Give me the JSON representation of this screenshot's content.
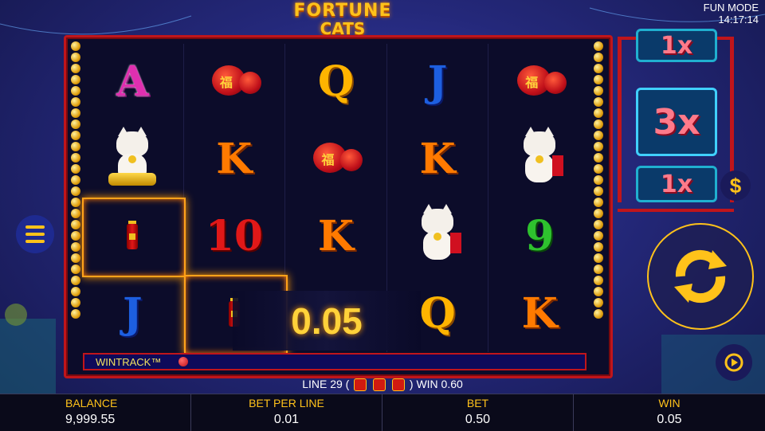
{
  "header": {
    "logo_line1": "FORTUNE",
    "logo_line2": "CATS",
    "mode": "FUN MODE",
    "time": "14:17:14"
  },
  "reels": [
    [
      "A",
      "lantern",
      "Q",
      "J",
      "lantern"
    ],
    [
      "cat-gold",
      "K",
      "lantern",
      "K",
      "cat"
    ],
    [
      "firecracker",
      "10",
      "K",
      "cat",
      "9"
    ],
    [
      "J",
      "firecracker",
      "",
      "Q",
      "K"
    ]
  ],
  "lantern_text": "福",
  "multipliers": [
    "1x",
    "3x",
    "1x"
  ],
  "win_popup": "0.05",
  "wintrack_label": "WINTRACK™",
  "line_info": {
    "line": "LINE 29 (",
    "close": ")",
    "win": "WIN 0.60"
  },
  "dollar_symbol": "$",
  "bottom": {
    "balance_label": "BALANCE",
    "balance_value": "9,999.55",
    "bet_per_line_label": "BET PER LINE",
    "bet_per_line_value": "0.01",
    "bet_label": "BET",
    "bet_value": "0.50",
    "win_label": "WIN",
    "win_value": "0.05"
  },
  "colors": {
    "accent": "#ffc21a",
    "frame_red": "#c0151b",
    "background": "#24287a"
  }
}
